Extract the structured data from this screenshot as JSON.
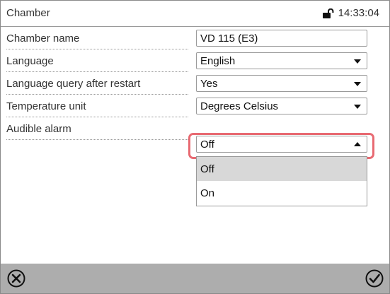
{
  "header": {
    "title": "Chamber",
    "time": "14:33:04",
    "status_icon": "lock-open-icon"
  },
  "settings": [
    {
      "label": "Chamber name",
      "value": "VD 115 (E3)",
      "type": "text"
    },
    {
      "label": "Language",
      "value": "English",
      "type": "select"
    },
    {
      "label": "Language query after restart",
      "value": "Yes",
      "type": "select"
    },
    {
      "label": "Temperature unit",
      "value": "Degrees Celsius",
      "type": "select"
    },
    {
      "label": "Audible alarm",
      "value": "Off",
      "type": "select",
      "expanded": true
    }
  ],
  "dropdown": {
    "options": [
      "Off",
      "On"
    ],
    "selected": "Off"
  },
  "footer": {
    "cancel_icon": "cancel-circle-icon",
    "confirm_icon": "confirm-check-icon"
  },
  "colors": {
    "highlight": "#e86a72",
    "footer_bg": "#adadad",
    "selected_option_bg": "#d8d8d8"
  }
}
